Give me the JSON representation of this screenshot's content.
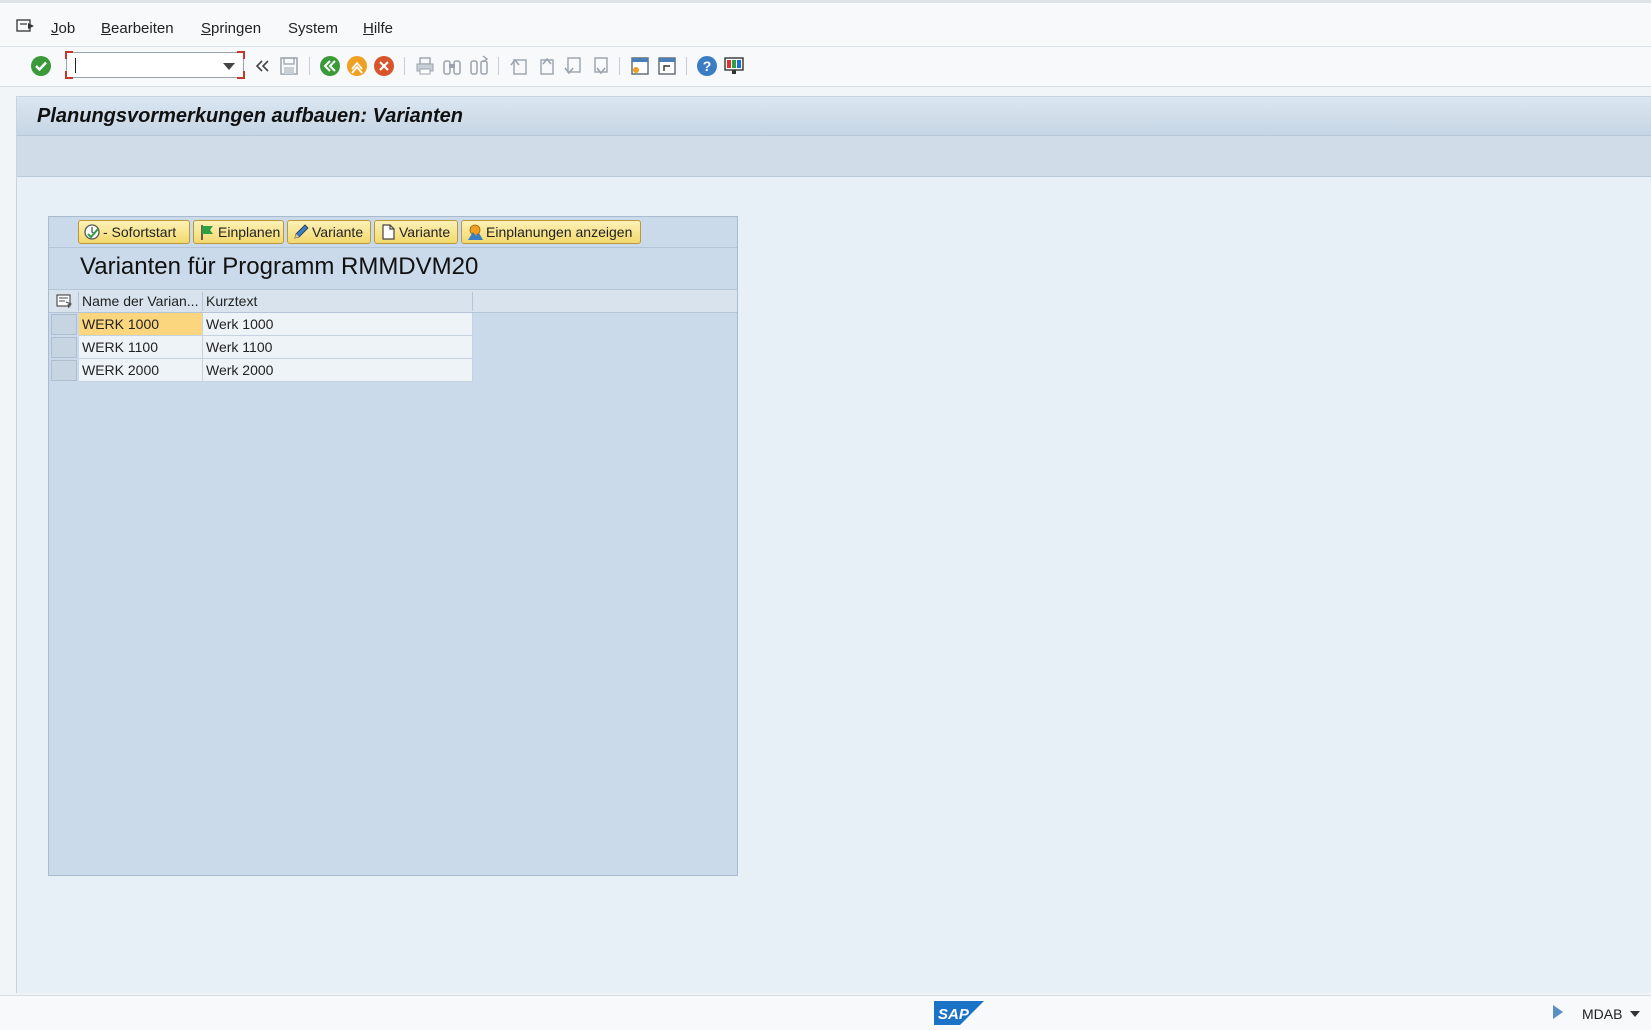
{
  "menu": {
    "items": [
      {
        "first": "J",
        "rest": "ob"
      },
      {
        "first": "B",
        "rest": "earbeiten"
      },
      {
        "first": "S",
        "rest": "pringen"
      },
      {
        "first": "",
        "rest": "System"
      },
      {
        "first": "H",
        "rest": "ilfe"
      }
    ]
  },
  "toolbar": {
    "command_value": "",
    "icons": [
      "enter-icon",
      "back-icon",
      "exit-icon",
      "cancel-icon",
      "save-icon",
      "print-icon",
      "find-icon",
      "find-next-icon",
      "first-page-icon",
      "previous-page-icon",
      "next-page-icon",
      "last-page-icon",
      "create-session-icon",
      "shortcut-icon",
      "help-icon",
      "customize-layout-icon"
    ]
  },
  "page": {
    "title": "Planungsvormerkungen aufbauen: Varianten"
  },
  "panel": {
    "buttons": [
      {
        "label": "- Sofortstart",
        "icon": "execute-immediately-icon"
      },
      {
        "label": "Einplanen",
        "icon": "flag-icon"
      },
      {
        "label": "Variante",
        "icon": "pencil-icon"
      },
      {
        "label": "Variante",
        "icon": "new-document-icon"
      },
      {
        "label": "Einplanungen anzeigen",
        "icon": "display-schedules-icon"
      }
    ],
    "title": "Varianten für Programm RMMDVM20",
    "columns": [
      "Name der Varian...",
      "Kurztext"
    ],
    "rows": [
      {
        "name": "WERK 1000",
        "text": "Werk 1000"
      },
      {
        "name": "WERK 1100",
        "text": "Werk 1100"
      },
      {
        "name": "WERK 2000",
        "text": "Werk 2000"
      }
    ]
  },
  "statusbar": {
    "system": "MDAB"
  },
  "colors": {
    "accent_button": "#f2d86c",
    "title_bar": "#c6d6e5",
    "selected_cell": "#fbd67f",
    "sap_blue": "#1a73c7"
  }
}
